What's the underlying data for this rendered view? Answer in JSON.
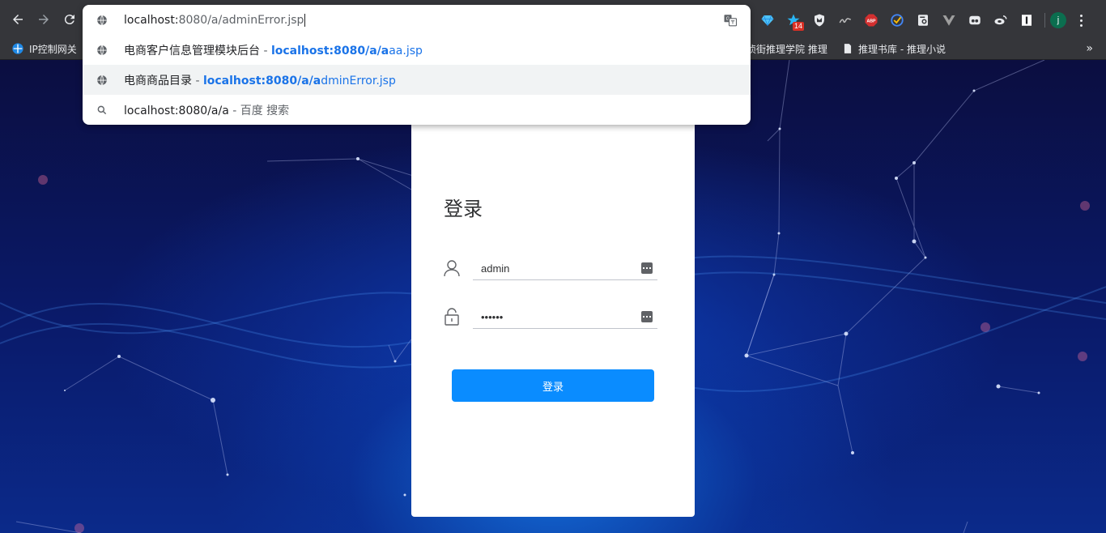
{
  "browser": {
    "omnibox_text_host": "localhost:",
    "omnibox_text_rest": "8080/a/adminError.jsp",
    "suggestions": [
      {
        "title": "电商客户信息管理模块后台",
        "sep": " - ",
        "url_match": "localhost:8080/a/a",
        "url_rest": "aa.jsp",
        "icon": "globe-icon"
      },
      {
        "title": "电商商品目录",
        "sep": " - ",
        "url_match": "localhost:8080/a/a",
        "url_rest": "dminError.jsp",
        "icon": "globe-icon"
      },
      {
        "query": "localhost:8080/a/a",
        "sep": " - ",
        "engine": "百度 搜索",
        "icon": "search-icon"
      }
    ],
    "bookmarks": {
      "first": "IP控制网关",
      "mid": "侦街推理学院 推理",
      "last": "推理书库 - 推理小说"
    },
    "extension_badge": "14",
    "avatar_letter": "j"
  },
  "login": {
    "title": "登录",
    "username_value": "admin",
    "password_value": "••••••",
    "submit_label": "登录"
  },
  "colors": {
    "accent": "#0a8cff",
    "chrome": "#35363a",
    "link": "#1a73e8"
  }
}
